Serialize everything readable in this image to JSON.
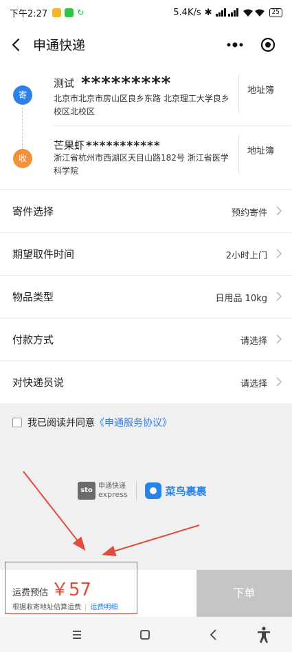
{
  "status_bar": {
    "time": "下午2:27",
    "network_speed": "5.4K/s",
    "battery": "25",
    "icons": [
      "app-notification-icon",
      "wechat-icon",
      "sync-icon",
      "bluetooth-icon",
      "signal-icon",
      "wifi-icon",
      "battery-icon"
    ]
  },
  "nav": {
    "title": "申通快递"
  },
  "sender": {
    "badge": "寄",
    "name": "测试",
    "masked": "*********",
    "address": "北京市北京市房山区良乡东路 北京理工大学良乡校区北校区",
    "book_label": "地址簿"
  },
  "receiver": {
    "badge": "收",
    "name": "芒果虾",
    "masked": "***********",
    "address": "浙江省杭州市西湖区天目山路182号 浙江省医学科学院",
    "book_label": "地址簿"
  },
  "options": [
    {
      "label": "寄件选择",
      "value": "预约寄件"
    },
    {
      "label": "期望取件时间",
      "value": "2小时上门"
    },
    {
      "label": "物品类型",
      "value": "日用品 10kg"
    },
    {
      "label": "付款方式",
      "value": "请选择"
    },
    {
      "label": "对快递员说",
      "value": "请选择"
    }
  ],
  "agreement": {
    "text": "我已阅读并同意",
    "link": "《申通服务协议》"
  },
  "logos": {
    "sto_mark": "sto",
    "sto_cn": "申通快递",
    "sto_en": "express",
    "cainiao": "菜鸟裹裹"
  },
  "footer": {
    "fee_label": "运费预估",
    "fee_amount": "￥57",
    "fee_note": "根据收寄地址估算运费",
    "fee_detail_link": "运费明细",
    "submit_label": "下单"
  },
  "colors": {
    "accent_blue": "#2f80e6",
    "accent_orange": "#f3913a",
    "annotation_red": "#e44b3d",
    "disabled_button": "#c5c5c5"
  }
}
